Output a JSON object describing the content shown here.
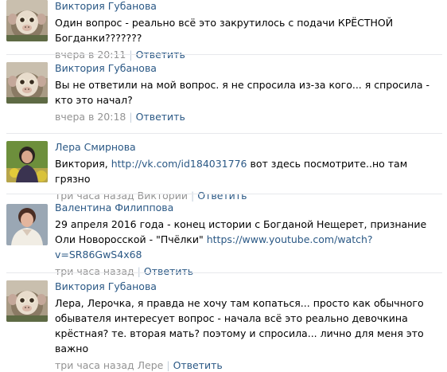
{
  "comments": [
    {
      "author": "Виктория Губанова",
      "avatar": "monkey-avatar",
      "text": "Один вопрос - реально всё это закрутилось с подачи КРЁСТНОЙ Богданки???????",
      "time": "вчера в 20:11",
      "reply_label": "Ответить"
    },
    {
      "author": "Виктория Губанова",
      "avatar": "monkey-avatar",
      "text": "Вы не ответили на мой вопрос. я не спросила из-за кого... я спросила - кто это начал?",
      "time": "вчера в 20:18",
      "reply_label": "Ответить"
    },
    {
      "author": "Лера Смирнова",
      "avatar": "woman-photo-avatar",
      "text_prefix": "Виктория, ",
      "link": "http://vk.com/id184031776",
      "text_suffix": " вот здесь посмотрите..но там грязно",
      "time": "три часа назад Виктории",
      "reply_label": "Ответить"
    },
    {
      "author": "Валентина Филиппова",
      "avatar": "woman-portrait-avatar",
      "text_prefix": "29 апреля 2016 года - конец истории с Богданой Нещерет, признание Оли Новоросской - \"Пчёлки\" ",
      "link": "https://www.youtube.com/watch?v=SR86GwS4x68",
      "time": "три часа назад",
      "reply_label": "Ответить"
    },
    {
      "author": "Виктория Губанова",
      "avatar": "monkey-avatar",
      "text": "Лера, Лерочка, я правда не хочу там копаться... просто как обычного обывателя интересует вопрос - начала всё это реально девочкина крёстная? те. вторая мать? поэтому и спросила... лично для меня это важно",
      "time": "три часа назад Лере",
      "reply_label": "Ответить"
    }
  ],
  "colors": {
    "link": "#2a5885",
    "meta": "#939393",
    "divider": "#e7e8ec",
    "text": "#000000"
  }
}
